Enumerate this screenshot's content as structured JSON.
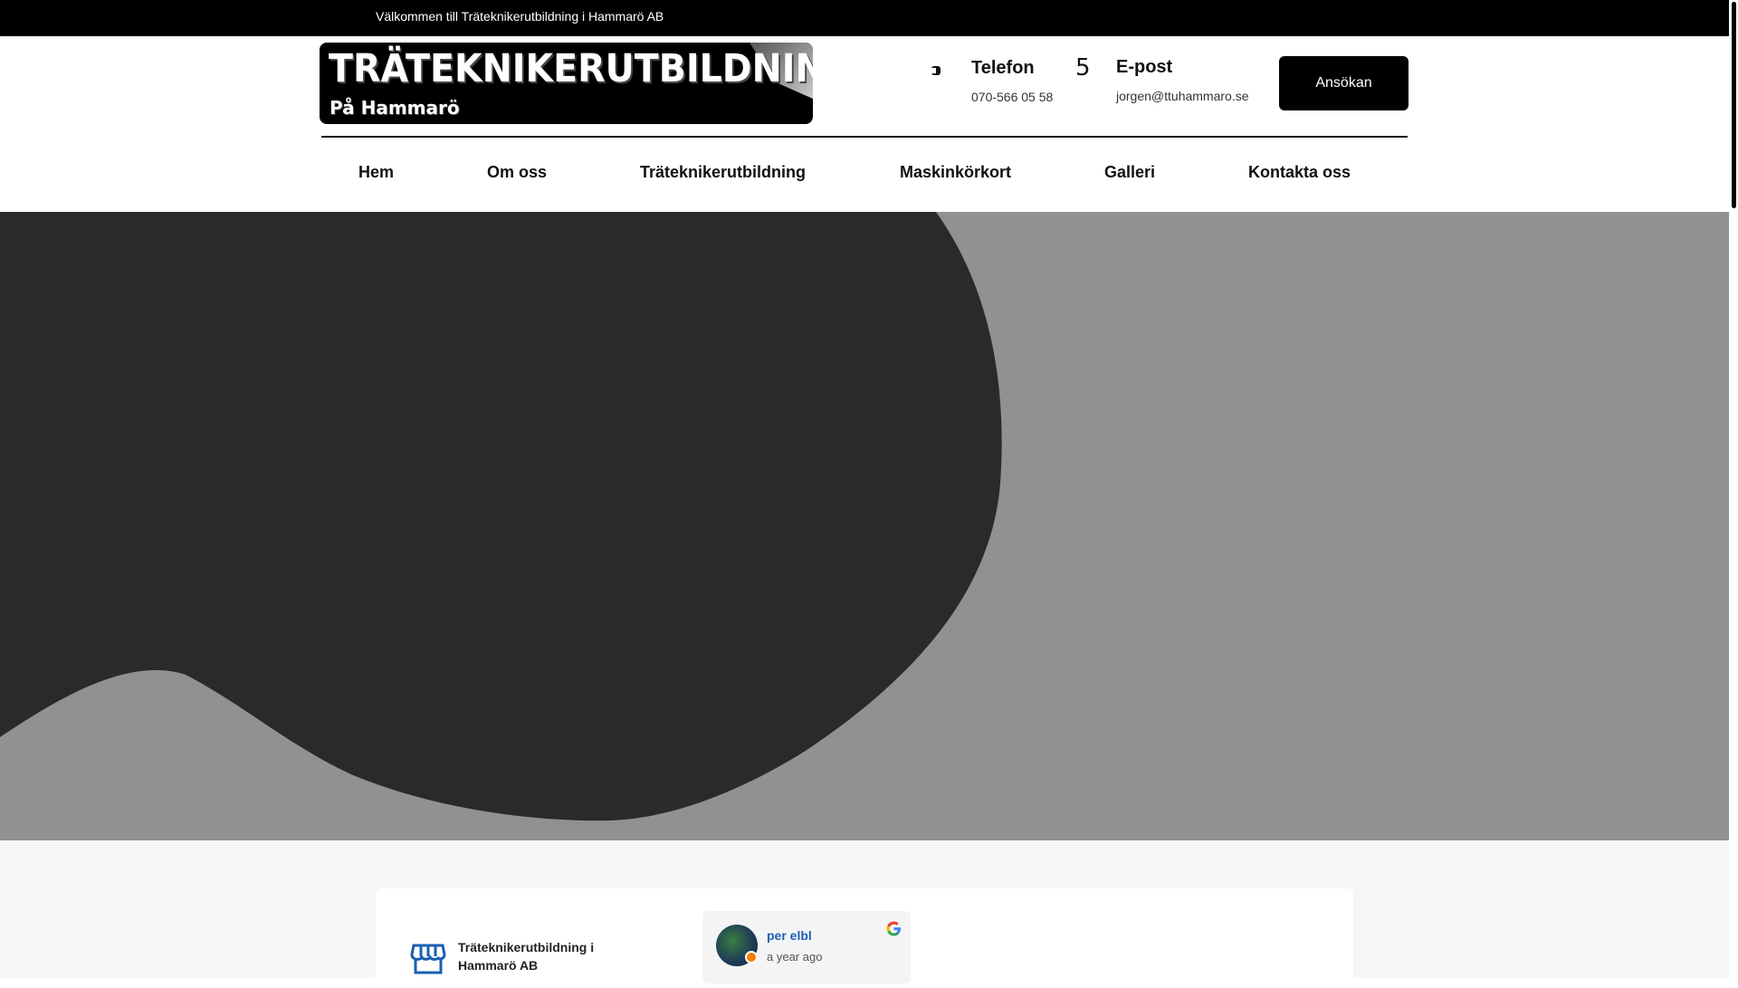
{
  "topbar": {
    "welcome": "Välkommen till Träteknikerutbildning i Hammarö AB"
  },
  "logo": {
    "title": "TRÄTEKNIKERUTBILDNING",
    "subtitle": "På Hammarö"
  },
  "contact": {
    "phone_title": "Telefon",
    "phone_value": "070-566 05 58",
    "mail_icon": "5",
    "mail_title": "E-post",
    "mail_value": "jorgen@ttuhammaro.se"
  },
  "apply_button": "Ansökan",
  "nav": {
    "items": [
      {
        "label": "Hem"
      },
      {
        "label": "Om oss"
      },
      {
        "label": "Träteknikerutbildning"
      },
      {
        "label": "Maskinkörkort"
      },
      {
        "label": "Galleri"
      },
      {
        "label": "Kontakta oss"
      }
    ]
  },
  "reviews": {
    "business_name": "Träteknikerutbildning i Hammarö AB",
    "reviewer": "per elbl",
    "time": "a year ago"
  },
  "colors": {
    "topbar": "#000000",
    "hero_background": "#919191",
    "hero_shape": "#2a2a2a",
    "link_blue": "#1a5fb4"
  },
  "icons": [
    "phone-icon",
    "mail-icon",
    "store-icon",
    "google-icon"
  ]
}
